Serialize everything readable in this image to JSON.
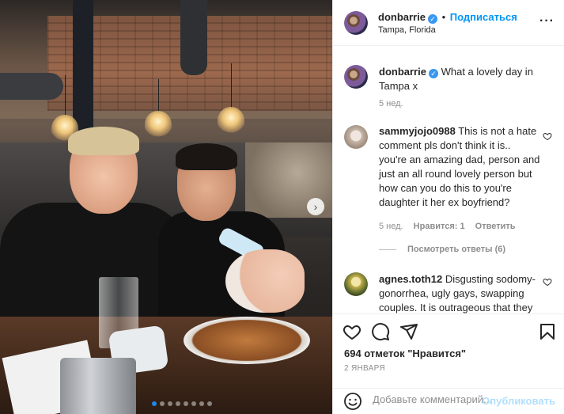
{
  "post": {
    "author": "donbarrie",
    "follow_label": "Подписаться",
    "location": "Tampa, Florida",
    "caption": "What a lovely day in Tampa x",
    "caption_time": "5 нед.",
    "likes": "694 отметок \"Нравится\"",
    "date": "2 ЯНВАРЯ",
    "carousel_total": 8,
    "carousel_active": 0
  },
  "comments": [
    {
      "username": "sammyjojo0988",
      "text": "This is not a hate comment pls don't think it is.. you're an amazing dad, person and just an all round lovely person but how can you do this to you're daughter it her ex boyfriend?",
      "time": "5 нед.",
      "likes_label": "Нравится: 1",
      "reply_label": "Ответить",
      "view_replies": "Посмотреть ответы (6)"
    },
    {
      "username": "agnes.toth12",
      "text": "Disgusting sodomy-gonorrhea, ugly gays, swapping couples. It is outrageous that they"
    }
  ],
  "add_comment": {
    "placeholder": "Добавьте комментарий...",
    "publish_label": "Опубликовать"
  },
  "icons": {
    "more": "more-options-icon",
    "like": "heart-icon",
    "comment": "comment-icon",
    "share": "paper-plane-icon",
    "save": "bookmark-icon",
    "emoji": "emoji-icon",
    "next": "chevron-right-icon"
  },
  "colors": {
    "accent": "#0095f6",
    "verified": "#3897f0",
    "muted": "#8e8e8e",
    "publish_disabled": "#b2dffc"
  }
}
